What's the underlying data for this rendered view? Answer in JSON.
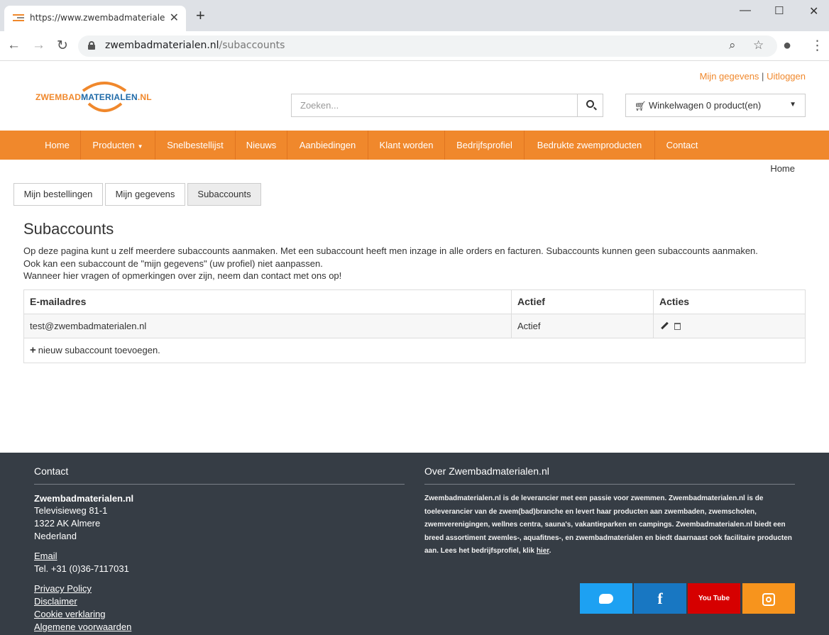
{
  "browser": {
    "tab_title": "https://www.zwembadmaterialen.nl/subaccounts",
    "url_domain": "zwembadmaterialen.nl",
    "url_path": "/subaccounts"
  },
  "header": {
    "logo_part1": "ZWEMBAD",
    "logo_part2": "MATERIALEN",
    "logo_part3": ".NL",
    "link_profile": "Mijn gegevens",
    "link_sep": "|",
    "link_logout": "Uitloggen",
    "search_placeholder": "Zoeken...",
    "cart_label": "Winkelwagen 0 product(en)"
  },
  "nav": {
    "items": [
      "Home",
      "Producten",
      "Snelbestellijst",
      "Nieuws",
      "Aanbiedingen",
      "Klant worden",
      "Bedrijfsprofiel",
      "Bedrukte zwemproducten",
      "Contact"
    ]
  },
  "breadcrumb": "Home",
  "account_tabs": [
    "Mijn bestellingen",
    "Mijn gegevens",
    "Subaccounts"
  ],
  "page": {
    "title": "Subaccounts",
    "intro_1": "Op deze pagina kunt u zelf meerdere subaccounts aanmaken. Met een subaccount heeft men inzage in alle orders en facturen. Subaccounts kunnen geen subaccounts aanmaken.",
    "intro_2": "Ook kan een subaccount de \"mijn gegevens\" (uw profiel) niet aanpassen.",
    "intro_3": "Wanneer hier vragen of opmerkingen over zijn, neem dan contact met ons op!"
  },
  "table": {
    "headers": [
      "E-mailadres",
      "Actief",
      "Acties"
    ],
    "rows": [
      {
        "email": "test@zwembadmaterialen.nl",
        "status": "Actief"
      }
    ],
    "add_label": "nieuw subaccount toevoegen."
  },
  "footer": {
    "contact_heading": "Contact",
    "company": "Zwembadmaterialen.nl",
    "street": "Televisieweg 81-1",
    "city": "1322 AK Almere",
    "country": "Nederland",
    "email_link": "Email",
    "phone": "Tel. +31 (0)36-7117031",
    "links": [
      "Privacy Policy",
      "Disclaimer",
      "Cookie verklaring",
      "Algemene voorwaarden"
    ],
    "about_heading": "Over Zwembadmaterialen.nl",
    "about_text": "Zwembadmaterialen.nl is de leverancier met een passie voor zwemmen. Zwembadmaterialen.nl is de toeleverancier van de zwem(bad)branche en levert haar producten aan zwembaden, zwemscholen, zwemverenigingen, wellnes centra, sauna's, vakantieparken en campings. Zwembadmaterialen.nl biedt een breed assortiment zwemles-, aquafitnes-, en zwembadmaterialen en biedt daarnaast ook facilitaire producten aan. Lees het bedrijfsprofiel, klik ",
    "about_link": "hier",
    "about_end": ".",
    "youtube_text": "You Tube",
    "facebook_text": "f"
  }
}
